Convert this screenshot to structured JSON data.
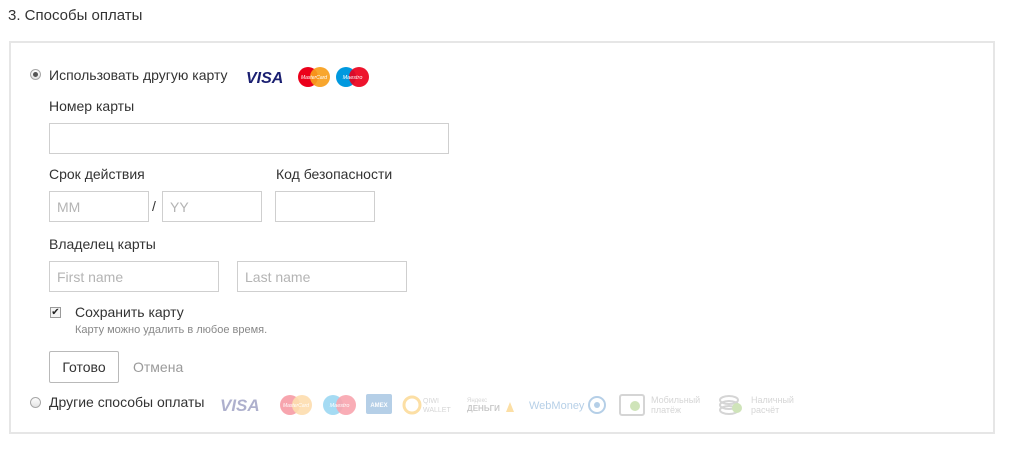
{
  "section": {
    "title": "3. Способы оплаты"
  },
  "card_option": {
    "label": "Использовать другую карту",
    "brands": [
      "VISA",
      "MasterCard",
      "Maestro"
    ]
  },
  "card_number": {
    "label": "Номер карты",
    "value": "",
    "placeholder": ""
  },
  "expiry": {
    "label": "Срок действия",
    "month_placeholder": "MM",
    "separator": "/",
    "year_placeholder": "YY"
  },
  "cvc": {
    "label": "Код безопасности",
    "value": ""
  },
  "holder": {
    "label": "Владелец карты",
    "first_placeholder": "First name",
    "last_placeholder": "Last name"
  },
  "save_card": {
    "label": "Сохранить карту",
    "hint": "Карту можно удалить в любое время.",
    "checked": true
  },
  "actions": {
    "done_label": "Готово",
    "cancel_label": "Отмена"
  },
  "other_option": {
    "label": "Другие способы оплаты",
    "methods": {
      "visa": "VISA",
      "mastercard": "MasterCard",
      "maestro": "Maestro",
      "amex": "AMEX",
      "qiwi_top": "QIWI",
      "qiwi_bottom": "WALLET",
      "yandex_top": "Яндекс",
      "yandex_bottom": "ДЕНЬГИ",
      "webmoney": "WebMoney",
      "mobile_top": "Мобильный",
      "mobile_bottom": "платёж",
      "cash_top": "Наличный",
      "cash_bottom": "расчёт"
    }
  },
  "colors": {
    "visa_blue": "#1a1f71",
    "mc_red": "#eb001b",
    "mc_yellow": "#f79e1b",
    "maestro_blue": "#0099df",
    "border": "#e6e6e6",
    "muted": "#9a9a9a"
  }
}
